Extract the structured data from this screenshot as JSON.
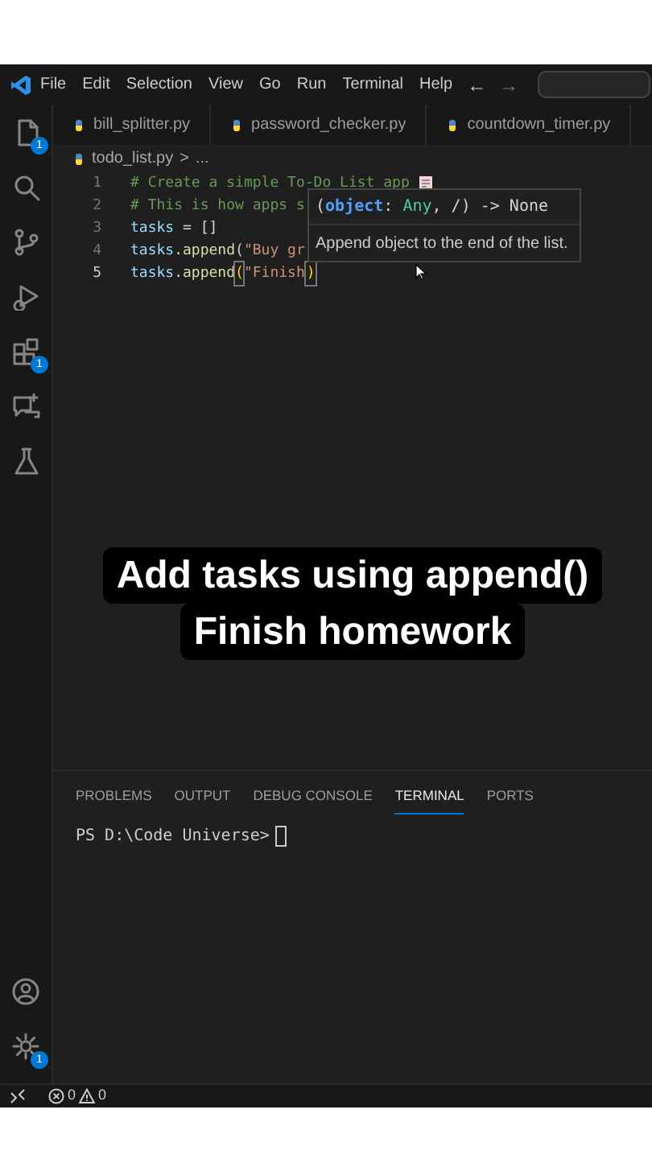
{
  "menu": [
    "File",
    "Edit",
    "Selection",
    "View",
    "Go",
    "Run",
    "Terminal",
    "Help"
  ],
  "nav_arrows": [
    "←",
    "→"
  ],
  "activity": [
    {
      "kind": "files",
      "badge": "1"
    },
    {
      "kind": "search"
    },
    {
      "kind": "branch"
    },
    {
      "kind": "debug"
    },
    {
      "kind": "extensions",
      "badge": "1"
    },
    {
      "kind": "chat"
    },
    {
      "kind": "flask"
    }
  ],
  "activity_bottom": [
    {
      "kind": "account"
    },
    {
      "kind": "gear",
      "badge": "1"
    }
  ],
  "tabs": [
    {
      "label": "bill_splitter.py",
      "selected": false
    },
    {
      "label": "password_checker.py",
      "selected": false
    },
    {
      "label": "countdown_timer.py",
      "selected": false
    }
  ],
  "breadcrumb": {
    "file": "todo_list.py",
    "separator": ">",
    "rest": "..."
  },
  "code": [
    {
      "number": "1",
      "current": false,
      "tokens": [
        {
          "text": "# Create a simple To-Do List app",
          "kind": "comment"
        }
      ],
      "emoji": true
    },
    {
      "number": "2",
      "current": false,
      "tokens": [
        {
          "text": "# This is how apps s",
          "kind": "comment"
        }
      ]
    },
    {
      "number": "3",
      "current": false,
      "tokens": [
        {
          "text": "tasks",
          "kind": "var"
        },
        {
          "text": " = []",
          "kind": "plain"
        }
      ]
    },
    {
      "number": "4",
      "current": false,
      "tokens": [
        {
          "text": "tasks",
          "kind": "var"
        },
        {
          "text": ".append",
          "kind": "func"
        },
        {
          "text": "(",
          "kind": "plain"
        },
        {
          "text": "\"Buy gr",
          "kind": "string"
        }
      ]
    },
    {
      "number": "5",
      "current": true,
      "tokens": [
        {
          "text": "tasks",
          "kind": "var"
        },
        {
          "text": ".append",
          "kind": "func"
        },
        {
          "text": "(",
          "kind": "bracket"
        },
        {
          "text": "\"Finish",
          "kind": "string"
        },
        {
          "text": ")",
          "kind": "bracket"
        }
      ]
    }
  ],
  "hover": {
    "signature": [
      {
        "text": "(",
        "kind": "plain"
      },
      {
        "text": "object",
        "kind": "param"
      },
      {
        "text": ": ",
        "kind": "plain"
      },
      {
        "text": "Any",
        "kind": "type"
      },
      {
        "text": ", /) -> None",
        "kind": "plain"
      }
    ],
    "doc": "Append object to the end of the list."
  },
  "caption": [
    "Add tasks using append()",
    "Finish homework"
  ],
  "panel_tabs": [
    {
      "label": "PROBLEMS",
      "selected": false
    },
    {
      "label": "OUTPUT",
      "selected": false
    },
    {
      "label": "DEBUG CONSOLE",
      "selected": false
    },
    {
      "label": "TERMINAL",
      "selected": true
    },
    {
      "label": "PORTS",
      "selected": false
    }
  ],
  "terminal": {
    "prompt": "PS D:\\Code Universe>"
  },
  "status": {
    "errors": "0",
    "warnings": "0"
  }
}
